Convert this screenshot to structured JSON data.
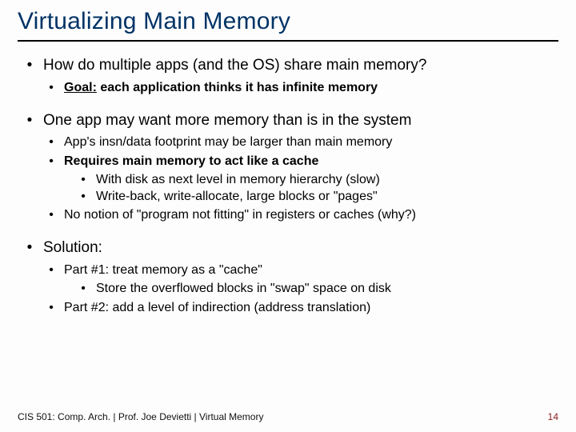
{
  "title": "Virtualizing Main Memory",
  "bullets": {
    "l1_1": "How do multiple apps (and the OS) share main memory?",
    "l1_1_sub": {
      "goal_label": "Goal:",
      "goal_rest": " each application thinks it has infinite memory"
    },
    "l1_2": "One app may want more memory than is in the system",
    "l1_2_sub": {
      "a": "App's insn/data footprint may be larger than main memory",
      "b": "Requires main memory to act like a cache",
      "b_sub": {
        "i": "With disk as next level in memory hierarchy (slow)",
        "ii": "Write-back, write-allocate, large blocks or \"pages\""
      },
      "c": "No notion of \"program not fitting\" in registers or caches (why?)"
    },
    "l1_3": "Solution:",
    "l1_3_sub": {
      "a": "Part #1: treat memory as a \"cache\"",
      "a_sub": {
        "i": "Store the overflowed blocks in \"swap\" space on disk"
      },
      "b": "Part #2: add a level of indirection (address translation)"
    }
  },
  "footer": {
    "left": "CIS 501: Comp. Arch.   |   Prof. Joe Devietti   |   Virtual Memory",
    "pagenum": "14"
  },
  "glyphs": {
    "bullet": "•"
  }
}
